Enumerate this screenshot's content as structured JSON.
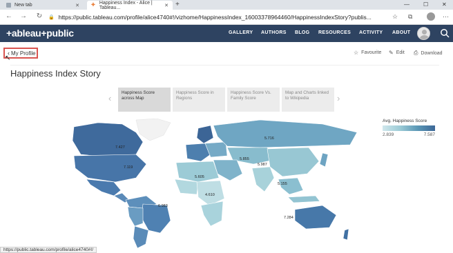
{
  "browser": {
    "tabs": [
      {
        "title": "New tab",
        "active": false
      },
      {
        "title": "Happiness Index - Alice | Tableau...",
        "active": true
      }
    ],
    "new_tab_symbol": "+",
    "url": "https://public.tableau.com/profile/alice4740#!/vizhome/HappinessIndex_16003378964460/HappinessIndexStory?publis...",
    "status_url": "https://public.tableau.com/profile/alice4740#!/"
  },
  "site": {
    "logo": "+ableau+public",
    "nav": [
      "GALLERY",
      "AUTHORS",
      "BLOG",
      "RESOURCES",
      "ACTIVITY",
      "ABOUT"
    ]
  },
  "profile_link": "My Profile",
  "actions": {
    "favourite": "Favourite",
    "edit": "Edit",
    "download": "Download"
  },
  "story": {
    "title": "Happiness Index Story",
    "points": [
      "Happiness Score across Map",
      "Happiness Score in Regions",
      "Happiness Score Vs. Family Score",
      "Map and Charts linked to Wikipedia"
    ]
  },
  "legend": {
    "title": "Avg. Happiness Score",
    "min": "2.839",
    "max": "7.587"
  },
  "map_values": [
    "7.427",
    "7.119",
    "5.716",
    "5.855",
    "5.987",
    "6.983",
    "7.284",
    "5.605",
    "5.155",
    "4.610"
  ],
  "colors": {
    "header_bg": "#2e4361",
    "highlight_border": "#d9534f",
    "legend_low": "#d0e7ec",
    "legend_high": "#3d6797"
  }
}
